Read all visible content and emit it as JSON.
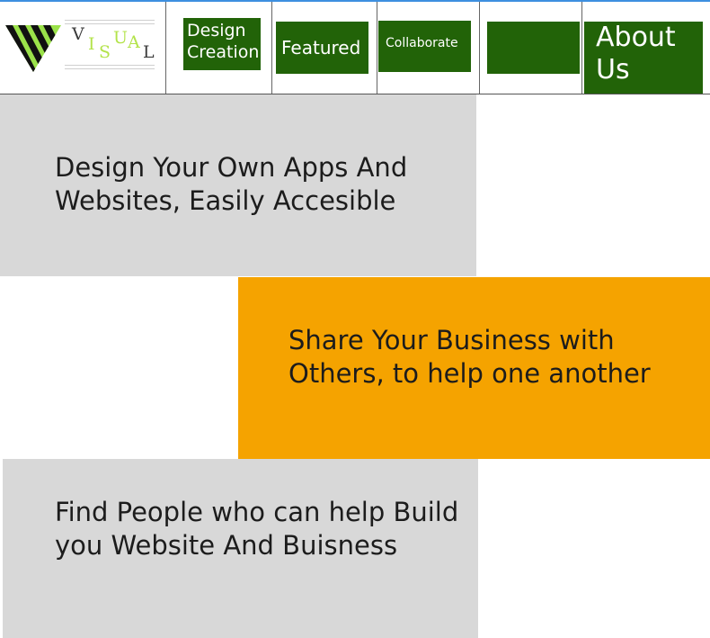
{
  "brand": {
    "logo_letters": [
      "V",
      "I",
      "S",
      "U",
      "A",
      "L"
    ],
    "logo_icon": "striped-triangle-logo-icon",
    "colors": {
      "letter_dark": "#3a3a3a",
      "letter_accent": "#b3e34a",
      "stripe_dark": "#111111",
      "stripe_light": "#9be24a"
    }
  },
  "nav": {
    "design_creation": "Design Creation",
    "featured": "Featured",
    "collaborate": "Collaborate",
    "blank": "",
    "about_us": "About Us"
  },
  "sections": [
    {
      "text": "Design Your Own Apps And Websites, Easily Accesible",
      "color": "#d8d8d8"
    },
    {
      "text": "Share Your Business with Others, to help one another",
      "color": "#f5a300"
    },
    {
      "text": "Find People who can help Build you Website And Buisness",
      "color": "#d8d8d8"
    }
  ],
  "colors": {
    "nav_green": "#226308",
    "accent_line": "#3d8fe0"
  }
}
